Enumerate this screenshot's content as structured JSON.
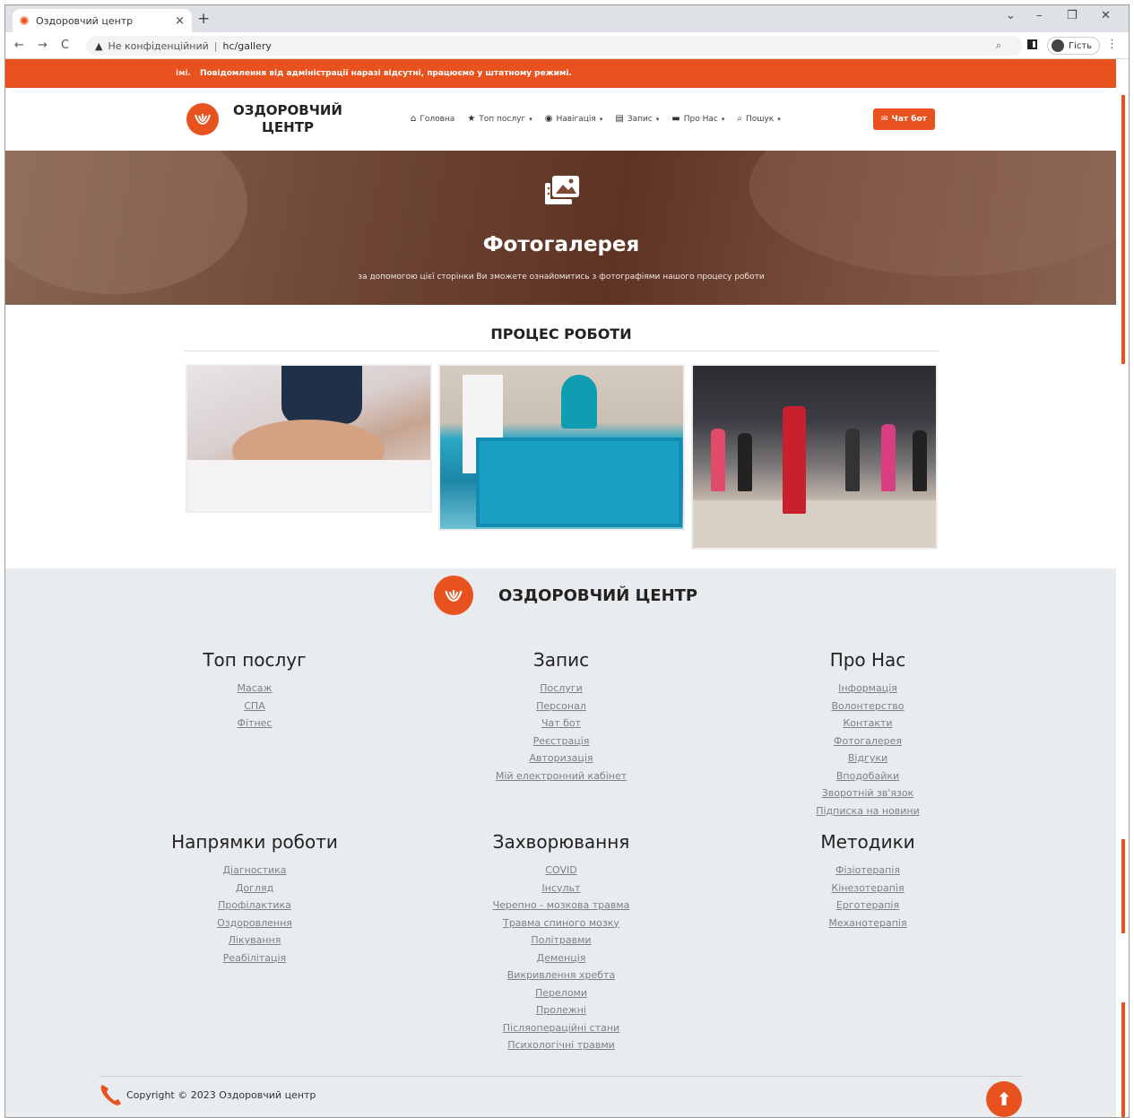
{
  "browser": {
    "tab_title": "Оздоровчий центр",
    "tab_close": "×",
    "new_tab": "+",
    "security_label": "Не конфіденційний",
    "url_path": "hc/gallery",
    "profile_label": "Гість",
    "win_min": "–",
    "win_max": "❐",
    "win_close": "✕",
    "win_down": "⌄"
  },
  "notice": {
    "prefix": "імі.",
    "text": "Повідомлення від адміністрації наразі відсутні, працюємо у штатному режимі."
  },
  "header": {
    "logo_text": "ОЗДОРОВЧИЙ ЦЕНТР",
    "menu": [
      {
        "label": "Головна",
        "icon": "home-icon",
        "caret": false
      },
      {
        "label": "Топ послуг",
        "icon": "star-icon",
        "caret": true
      },
      {
        "label": "Навігація",
        "icon": "compass-icon",
        "caret": true
      },
      {
        "label": "Запис",
        "icon": "clipboard-icon",
        "caret": true
      },
      {
        "label": "Про Нас",
        "icon": "id-card-icon",
        "caret": true
      },
      {
        "label": "Пошук",
        "icon": "search-icon",
        "caret": true
      }
    ],
    "chat_button": "Чат бот"
  },
  "hero": {
    "title": "Фотогалерея",
    "subtitle": "за допомогою цієї сторінки Ви зможете ознайомитись з фотографіями нашого процесу роботи"
  },
  "gallery": {
    "title": "ПРОЦЕС РОБОТИ"
  },
  "footer": {
    "logo_text": "ОЗДОРОВЧИЙ ЦЕНТР",
    "columns": [
      {
        "title": "Топ послуг",
        "links": [
          "Масаж",
          "СПА",
          "Фітнес"
        ]
      },
      {
        "title": "Запис",
        "links": [
          "Послуги",
          "Персонал",
          "Чат бот",
          "Реєстрація",
          "Авторизація",
          "Мій електронний кабінет"
        ]
      },
      {
        "title": "Про Нас",
        "links": [
          "Інформація",
          "Волонтерство",
          "Контакти",
          "Фотогалерея",
          "Відгуки",
          "Вподобайки",
          "Зворотній зв'язок",
          "Підписка на новини"
        ]
      },
      {
        "title": "Напрямки роботи",
        "links": [
          "Діагностика",
          "Догляд",
          "Профілактика",
          "Оздоровлення",
          "Лікування",
          "Реабілітація"
        ]
      },
      {
        "title": "Захворювання",
        "links": [
          "COVID",
          "Інсульт",
          "Черепно - мозкова травма",
          "Травма спиного мозку",
          "Політравми",
          "Деменція",
          "Викривлення хребта",
          "Переломи",
          "Пролежні",
          "Післяопераційні стани",
          "Психологічні травми"
        ]
      },
      {
        "title": "Методики",
        "links": [
          "Фізіотерапія",
          "Кінезотерапія",
          "Ерготерапія",
          "Механотерапія"
        ]
      }
    ],
    "copyright": "Copyright © 2023 Оздоровчий центр"
  },
  "colors": {
    "accent": "#e8521f",
    "footer_bg": "#e9ecef"
  }
}
